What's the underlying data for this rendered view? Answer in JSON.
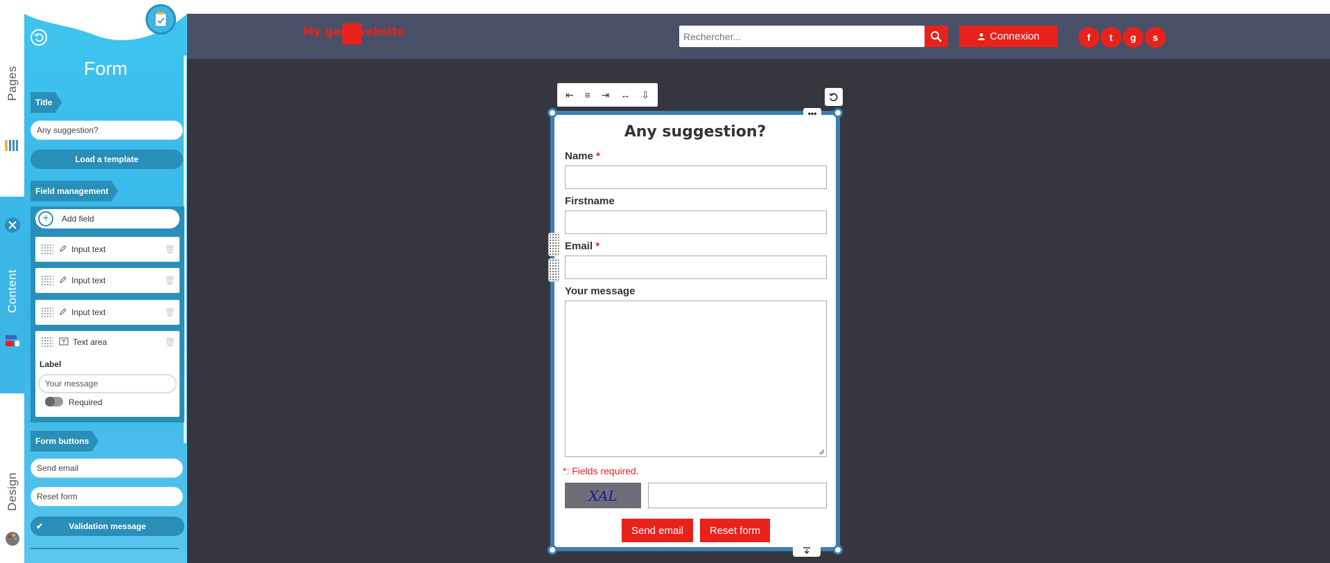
{
  "rail": {
    "tabs": [
      {
        "label": "Pages"
      },
      {
        "label": "Content"
      },
      {
        "label": "Design"
      }
    ],
    "close_icon": "close-icon"
  },
  "panel": {
    "title": "Form",
    "title_section": {
      "tag": "Title",
      "value": "Any suggestion?"
    },
    "load_template": "Load a template",
    "field_management": {
      "tag": "Field management",
      "add_field": "Add field",
      "fields": [
        {
          "type": "Input text"
        },
        {
          "type": "Input text"
        },
        {
          "type": "Input text"
        },
        {
          "type": "Text area"
        }
      ],
      "expanded": {
        "label_heading": "Label",
        "label_value": "Your message",
        "required_label": "Required"
      }
    },
    "form_buttons": {
      "tag": "Form buttons",
      "send_value": "Send email",
      "reset_value": "Reset form"
    },
    "validation_message": "Validation message"
  },
  "header": {
    "logo_text": "My gam  website",
    "search_placeholder": "Rechercher...",
    "login_label": "Connexion",
    "social": [
      "f",
      "t",
      "g",
      "s"
    ]
  },
  "form": {
    "title": "Any suggestion?",
    "fields": [
      {
        "label": "Name",
        "required_mark": "*"
      },
      {
        "label": "Firstname",
        "required_mark": ""
      },
      {
        "label": "Email",
        "required_mark": "*"
      },
      {
        "label": "Your message",
        "required_mark": ""
      }
    ],
    "required_note": "*: Fields required.",
    "captcha_text": "XAL",
    "send_label": "Send email",
    "reset_label": "Reset form"
  },
  "colors": {
    "accent": "#e8221b",
    "panel": "#3fc4ef",
    "frame": "#3d7fb2",
    "header": "#4a4f68",
    "canvas": "#36363f"
  }
}
